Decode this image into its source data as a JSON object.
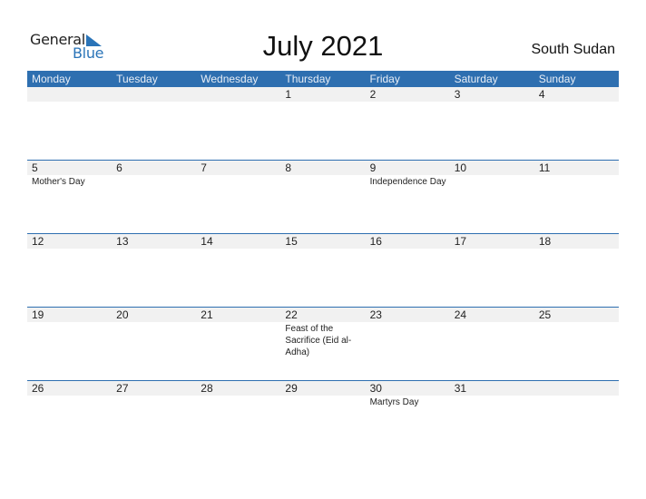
{
  "logo": {
    "line1": "General",
    "line2": "Blue"
  },
  "title": "July 2021",
  "country": "South Sudan",
  "colors": {
    "accent": "#2e6fb0",
    "strip": "#f1f1f1"
  },
  "weekdays": [
    "Monday",
    "Tuesday",
    "Wednesday",
    "Thursday",
    "Friday",
    "Saturday",
    "Sunday"
  ],
  "weeks": [
    [
      {
        "day": "",
        "event": ""
      },
      {
        "day": "",
        "event": ""
      },
      {
        "day": "",
        "event": ""
      },
      {
        "day": "1",
        "event": ""
      },
      {
        "day": "2",
        "event": ""
      },
      {
        "day": "3",
        "event": ""
      },
      {
        "day": "4",
        "event": ""
      }
    ],
    [
      {
        "day": "5",
        "event": "Mother's Day"
      },
      {
        "day": "6",
        "event": ""
      },
      {
        "day": "7",
        "event": ""
      },
      {
        "day": "8",
        "event": ""
      },
      {
        "day": "9",
        "event": "Independence Day"
      },
      {
        "day": "10",
        "event": ""
      },
      {
        "day": "11",
        "event": ""
      }
    ],
    [
      {
        "day": "12",
        "event": ""
      },
      {
        "day": "13",
        "event": ""
      },
      {
        "day": "14",
        "event": ""
      },
      {
        "day": "15",
        "event": ""
      },
      {
        "day": "16",
        "event": ""
      },
      {
        "day": "17",
        "event": ""
      },
      {
        "day": "18",
        "event": ""
      }
    ],
    [
      {
        "day": "19",
        "event": ""
      },
      {
        "day": "20",
        "event": ""
      },
      {
        "day": "21",
        "event": ""
      },
      {
        "day": "22",
        "event": "Feast of the Sacrifice (Eid al-Adha)"
      },
      {
        "day": "23",
        "event": ""
      },
      {
        "day": "24",
        "event": ""
      },
      {
        "day": "25",
        "event": ""
      }
    ],
    [
      {
        "day": "26",
        "event": ""
      },
      {
        "day": "27",
        "event": ""
      },
      {
        "day": "28",
        "event": ""
      },
      {
        "day": "29",
        "event": ""
      },
      {
        "day": "30",
        "event": "Martyrs Day"
      },
      {
        "day": "31",
        "event": ""
      },
      {
        "day": "",
        "event": ""
      }
    ]
  ]
}
